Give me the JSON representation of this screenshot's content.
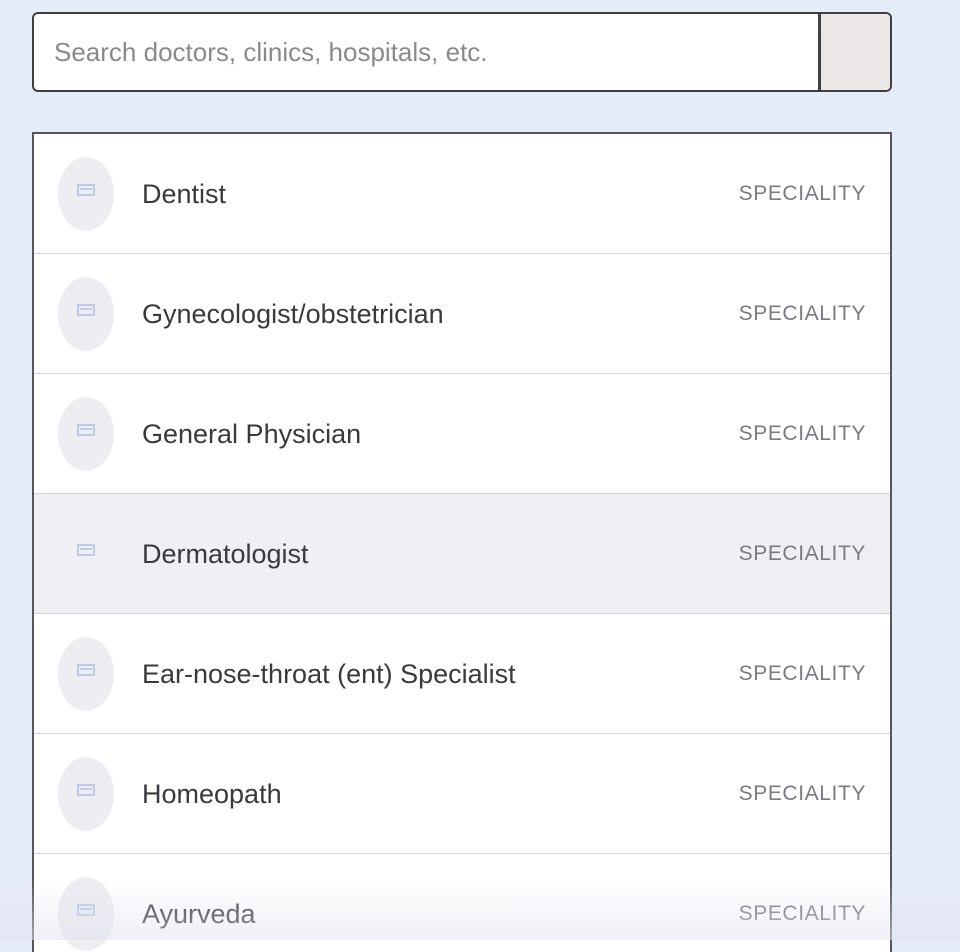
{
  "search": {
    "placeholder": "Search doctors, clinics, hospitals, etc.",
    "value": ""
  },
  "results": {
    "items": [
      {
        "label": "Dentist",
        "type": "SPECIALITY",
        "icon": "speciality-icon",
        "highlighted": false
      },
      {
        "label": "Gynecologist/obstetrician",
        "type": "SPECIALITY",
        "icon": "speciality-icon",
        "highlighted": false
      },
      {
        "label": "General Physician",
        "type": "SPECIALITY",
        "icon": "speciality-icon",
        "highlighted": false
      },
      {
        "label": "Dermatologist",
        "type": "SPECIALITY",
        "icon": "speciality-icon",
        "highlighted": true
      },
      {
        "label": "Ear-nose-throat (ent) Specialist",
        "type": "SPECIALITY",
        "icon": "speciality-icon",
        "highlighted": false
      },
      {
        "label": "Homeopath",
        "type": "SPECIALITY",
        "icon": "speciality-icon",
        "highlighted": false
      },
      {
        "label": "Ayurveda",
        "type": "SPECIALITY",
        "icon": "speciality-icon",
        "highlighted": false
      }
    ]
  },
  "colors": {
    "page_background": "#e6ebf8",
    "border": "#3f3f44",
    "highlight_row": "#f0f0f4",
    "icon_blue": "#aebfe3"
  }
}
